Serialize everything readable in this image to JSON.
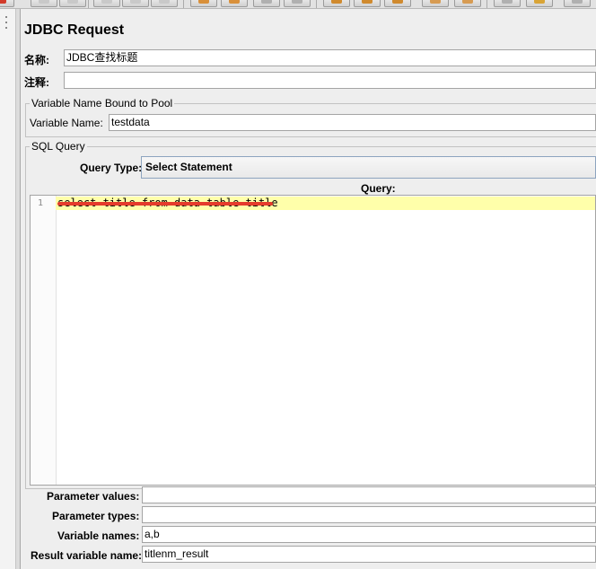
{
  "sampler": {
    "title": "JDBC Request",
    "name_label": "名称:",
    "name_value": "JDBC查找标题",
    "comments_label": "注释:",
    "comments_value": ""
  },
  "pool_section": {
    "legend": "Variable Name Bound to Pool",
    "variable_name_label": "Variable Name:",
    "variable_name_value": "testdata"
  },
  "sql_section": {
    "legend": "SQL Query",
    "query_type_label": "Query Type:",
    "query_type_value": "Select Statement",
    "query_label": "Query:",
    "query_line_number": "1",
    "query_text": "select title from data table title"
  },
  "params": {
    "parameter_values_label": "Parameter values:",
    "parameter_values_value": "",
    "parameter_types_label": "Parameter types:",
    "parameter_types_value": "",
    "variable_names_label": "Variable names:",
    "variable_names_value": "a,b",
    "result_variable_label": "Result variable name:",
    "result_variable_value": "titlenm_result"
  },
  "colors": {
    "current_line_highlight": "#ffffaa",
    "redaction_mark": "#e53b2c"
  }
}
